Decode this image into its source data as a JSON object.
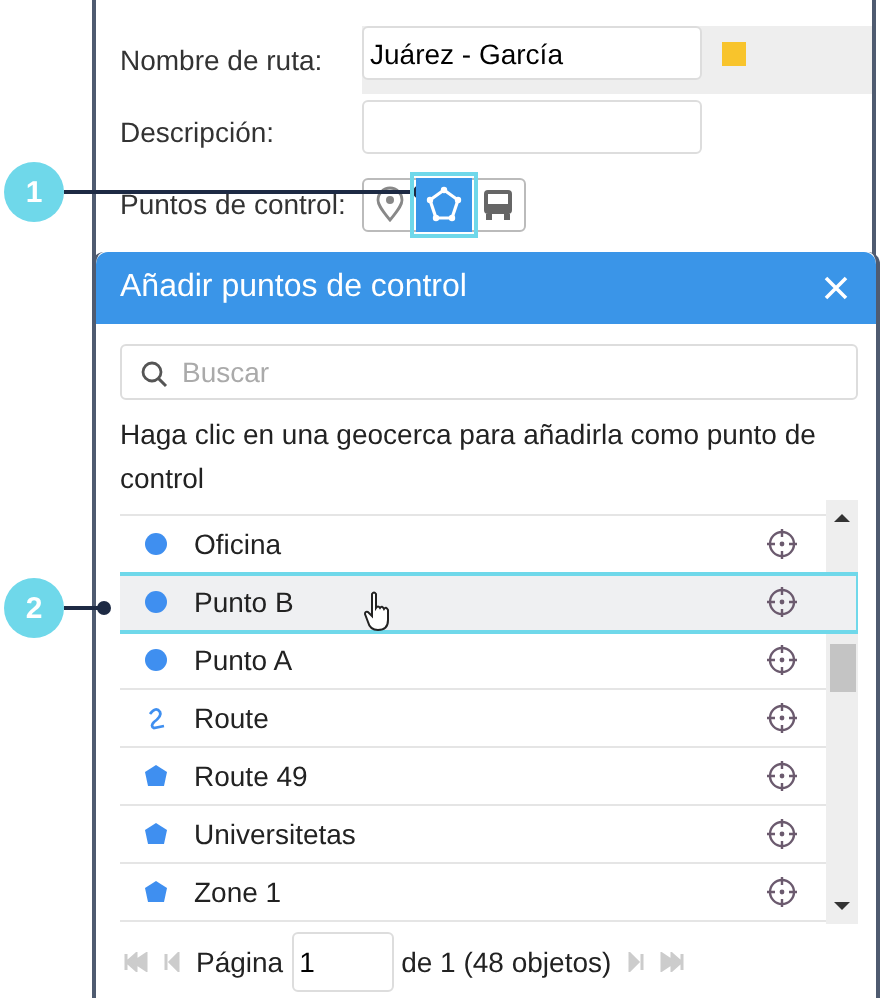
{
  "route_name": {
    "label": "Nombre de ruta:",
    "value": "Juárez - García",
    "color": "#f8c42c"
  },
  "description": {
    "label": "Descripción:"
  },
  "checkpoints": {
    "label": "Puntos de control:",
    "modes": [
      {
        "kind": "marker",
        "selected": false
      },
      {
        "kind": "polygon",
        "selected": true
      },
      {
        "kind": "unit",
        "selected": false
      }
    ]
  },
  "dialog": {
    "title": "Añadir puntos de control",
    "search": {
      "placeholder": "Buscar"
    },
    "hint": "Haga clic en una geocerca para añadirla como punto de control",
    "items": [
      {
        "name": "Oficina",
        "kind": "circle",
        "selected": false
      },
      {
        "name": "Punto B",
        "kind": "circle",
        "selected": true
      },
      {
        "name": "Punto A",
        "kind": "circle",
        "selected": false
      },
      {
        "name": "Route",
        "kind": "line",
        "selected": false
      },
      {
        "name": "Route 49",
        "kind": "polygon",
        "selected": false
      },
      {
        "name": "Universitetas",
        "kind": "polygon",
        "selected": false
      },
      {
        "name": "Zone 1",
        "kind": "polygon",
        "selected": false
      }
    ],
    "pagination": {
      "label": "Página",
      "page": "1",
      "total": "de 1 (48 objetos)"
    }
  },
  "callouts": [
    {
      "number": "1"
    },
    {
      "number": "2"
    }
  ]
}
